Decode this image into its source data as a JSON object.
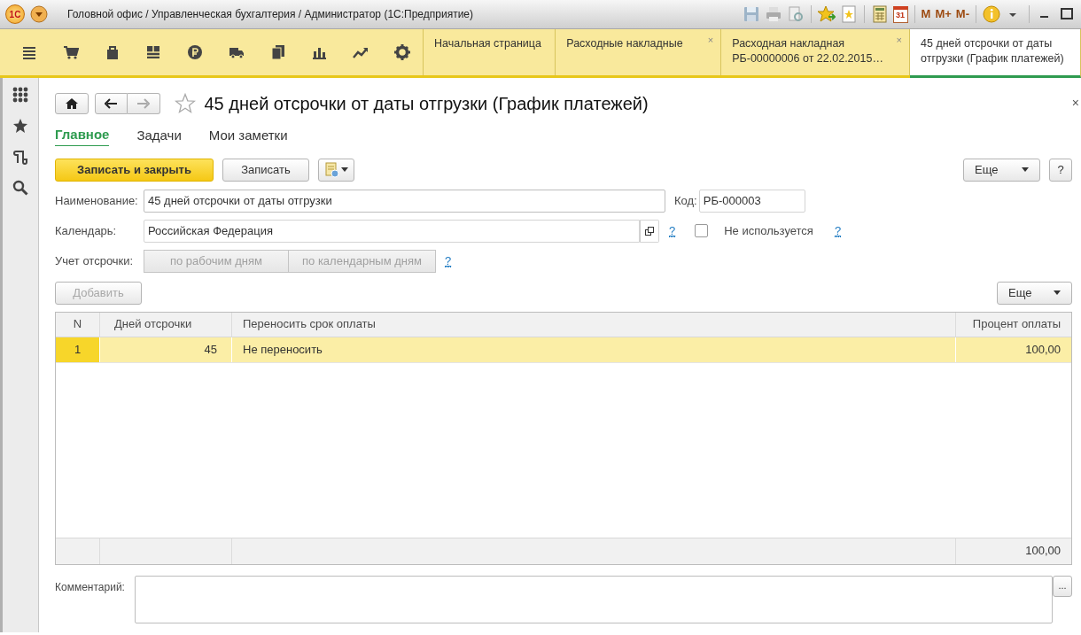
{
  "window": {
    "logo": "1С",
    "title": "Головной офис / Управленческая бухгалтерия / Администратор  (1С:Предприятие)",
    "tools": [
      {
        "kind": "calendar",
        "text": "31"
      },
      {
        "kind": "text",
        "text": "M"
      },
      {
        "kind": "text",
        "text": "M+"
      },
      {
        "kind": "text",
        "text": "M-"
      }
    ]
  },
  "tabs": [
    {
      "label": "Начальная страница",
      "selected": false
    },
    {
      "label": "Расходные накладные",
      "close": "×",
      "selected": false
    },
    {
      "label": "Расходная накладная РБ-00000006 от 22.02.2015…",
      "close": "×",
      "selected": false
    },
    {
      "label": "45 дней отсрочки от даты отгрузки (График платежей)",
      "selected": true
    }
  ],
  "form": {
    "title": "45 дней отсрочки от даты отгрузки (График платежей)",
    "close": "×",
    "favorite": false,
    "nav": [
      {
        "label": "Главное",
        "selected": true
      },
      {
        "label": "Задачи",
        "selected": false
      },
      {
        "label": "Мои заметки",
        "selected": false
      }
    ],
    "buttons": {
      "primary": "Записать и закрыть",
      "save": "Записать",
      "more": "Еще",
      "help": "?"
    },
    "name": {
      "label": "Наименование:",
      "value": "45 дней отсрочки от даты отгрузки"
    },
    "code": {
      "label": "Код:",
      "value": "РБ-000003"
    },
    "calendar": {
      "label": "Календарь:",
      "value": "Российская Федерация",
      "help": "?"
    },
    "unused": {
      "label": "Не используется",
      "checked": false,
      "help": "?"
    },
    "deferral": {
      "label": "Учет отсрочки:",
      "options": [
        {
          "label": "по рабочим дням",
          "selected": false
        },
        {
          "label": "по календарным дням",
          "selected": false
        }
      ],
      "disabled": true,
      "help": "?"
    },
    "add": {
      "label": "Добавить",
      "disabled": true
    },
    "table_more": "Еще",
    "table": {
      "columns": [
        "N",
        "Дней отсрочки",
        "Переносить срок оплаты",
        "Процент оплаты"
      ],
      "rows": [
        {
          "cells": [
            "1",
            "45",
            "Не переносить",
            "100,00"
          ],
          "selected": true
        }
      ],
      "total": "100,00"
    },
    "comment": {
      "label": "Комментарий:",
      "button": "..."
    }
  }
}
